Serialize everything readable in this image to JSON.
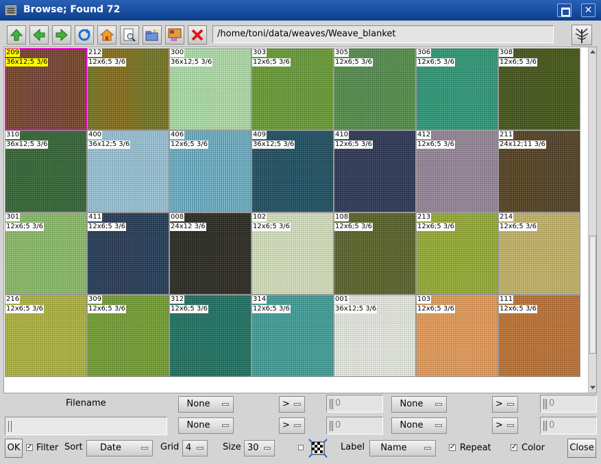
{
  "window": {
    "title": "Browse; Found 72",
    "maximize_icon": "maximize-icon",
    "close_glyph": "✕"
  },
  "toolbar": {
    "icons": [
      "arrow-up-icon",
      "arrow-left-icon",
      "arrow-right-icon",
      "refresh-icon",
      "home-icon",
      "preview-icon",
      "folder-open-icon",
      "image-label-icon",
      "delete-icon"
    ],
    "path": "/home/toni/data/weaves/Weave_blanket",
    "tree_icon": "tree-icon"
  },
  "colors": {
    "titlebar": "#1e56a8",
    "selection_border": "#e000c8",
    "selected_label_bg": "#ffff00"
  },
  "tiles": [
    {
      "name": "209",
      "info": "36x12;5 3/6",
      "color": "#6b3a2e",
      "thread": "#8a5a3a",
      "selected": true
    },
    {
      "name": "212",
      "info": "12x6;5 3/6",
      "color": "#8a7423",
      "thread": "#5a6a1e"
    },
    {
      "name": "300",
      "info": "36x12;5 3/6",
      "color": "#9fcf9a",
      "thread": "#bfe3b5"
    },
    {
      "name": "303",
      "info": "12x6;5 3/6",
      "color": "#6f9f3a",
      "thread": "#5a8a32"
    },
    {
      "name": "305",
      "info": "12x6;5 3/6",
      "color": "#5a9050",
      "thread": "#4a7e46"
    },
    {
      "name": "306",
      "info": "12x6;5 3/6",
      "color": "#2c9070",
      "thread": "#3aa080"
    },
    {
      "name": "308",
      "info": "12x6;5 3/6",
      "color": "#4c5c1e",
      "thread": "#3c4c18"
    },
    {
      "name": "310",
      "info": "36x12;5 3/6",
      "color": "#3a6a3a",
      "thread": "#2e5a30"
    },
    {
      "name": "400",
      "info": "36x12;5 3/6",
      "color": "#8cb4c8",
      "thread": "#a8cfe0"
    },
    {
      "name": "406",
      "info": "12x6;5 3/6",
      "color": "#5a9ab0",
      "thread": "#8ac8d8"
    },
    {
      "name": "409",
      "info": "36x12;5 3/6",
      "color": "#1e4a5a",
      "thread": "#2a5e70"
    },
    {
      "name": "410",
      "info": "12x6;5 3/6",
      "color": "#2a3450",
      "thread": "#3a4460"
    },
    {
      "name": "412",
      "info": "12x6;5 3/6",
      "color": "#8a7c8c",
      "thread": "#a492a6"
    },
    {
      "name": "211",
      "info": "24x12;11 3/6",
      "color": "#4a3a22",
      "thread": "#6a5430"
    },
    {
      "name": "301",
      "info": "12x6;5 3/6",
      "color": "#80b060",
      "thread": "#98c474"
    },
    {
      "name": "411",
      "info": "12x6;5 3/6",
      "color": "#22344e",
      "thread": "#34506a"
    },
    {
      "name": "008",
      "info": "24x12 3/6",
      "color": "#262620",
      "thread": "#3a3a30"
    },
    {
      "name": "102",
      "info": "12x6;5 3/6",
      "color": "#c8d4b0",
      "thread": "#dde6c8"
    },
    {
      "name": "108",
      "info": "12x6;5 3/6",
      "color": "#525a26",
      "thread": "#6a7434"
    },
    {
      "name": "213",
      "info": "12x6;5 3/6",
      "color": "#8aa030",
      "thread": "#a4b840"
    },
    {
      "name": "214",
      "info": "12x6;5 3/6",
      "color": "#b8a860",
      "thread": "#ccbc74"
    },
    {
      "name": "216",
      "info": "12x6;5 3/6",
      "color": "#a4a83a",
      "thread": "#b8bc4c"
    },
    {
      "name": "309",
      "info": "12x6;5 3/6",
      "color": "#6a9430",
      "thread": "#80aa3c"
    },
    {
      "name": "312",
      "info": "12x6;5 3/6",
      "color": "#1e6a5a",
      "thread": "#2a806e"
    },
    {
      "name": "314",
      "info": "12x6;5 3/6",
      "color": "#3a9490",
      "thread": "#50aaa4"
    },
    {
      "name": "001",
      "info": "36x12;5 3/6",
      "color": "#d8dcd4",
      "thread": "#eeeeea"
    },
    {
      "name": "103",
      "info": "12x6;5 3/6",
      "color": "#d89050",
      "thread": "#eaa868"
    },
    {
      "name": "111",
      "info": "12x6;5 3/6",
      "color": "#b06a30",
      "thread": "#c88040"
    }
  ],
  "controls": {
    "filename_label": "Filename",
    "filename_value": "",
    "row1": {
      "sel_a": "None",
      "cmp_a": ">",
      "num_a": "0",
      "sel_b": "None",
      "cmp_b": ">",
      "num_b": "0"
    },
    "row2": {
      "sel_a": "None",
      "cmp_a": ">",
      "num_a": "0",
      "sel_b": "None",
      "cmp_b": ">",
      "num_b": "0"
    },
    "ok_label": "OK",
    "filter_label": "Filter",
    "filter_checked": true,
    "sort_label": "Sort",
    "sort_value": "Date",
    "grid_label": "Grid",
    "grid_value": "4",
    "size_label": "Size",
    "size_value": "30",
    "weave_icon": "weave-pattern-icon",
    "label_label": "Label",
    "label_value": "Name",
    "repeat_label": "Repeat",
    "repeat_checked": true,
    "color_label": "Color",
    "color_checked": true,
    "close_label": "Close"
  }
}
